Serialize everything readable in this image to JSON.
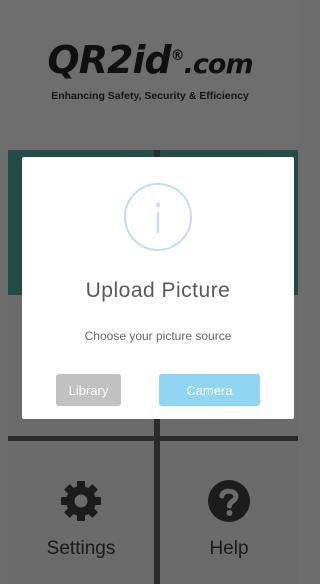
{
  "header": {
    "logo": {
      "main": "QR2id",
      "registered": "®",
      "domain": ".com"
    },
    "tagline": "Enhancing Safety, Security & Efficiency"
  },
  "tiles": [
    {
      "label": "Settings",
      "icon": "gear-icon"
    },
    {
      "label": "Help",
      "icon": "question-icon"
    }
  ],
  "modal": {
    "icon": "info-icon",
    "title": "Upload Picture",
    "message": "Choose your picture source",
    "buttons": {
      "library": "Library",
      "camera": "Camera"
    }
  },
  "colors": {
    "accent_teal": "#234d44",
    "camera_button": "#8ed6f3",
    "library_button": "#c1c1c1",
    "info_icon": "#c3dde9"
  }
}
